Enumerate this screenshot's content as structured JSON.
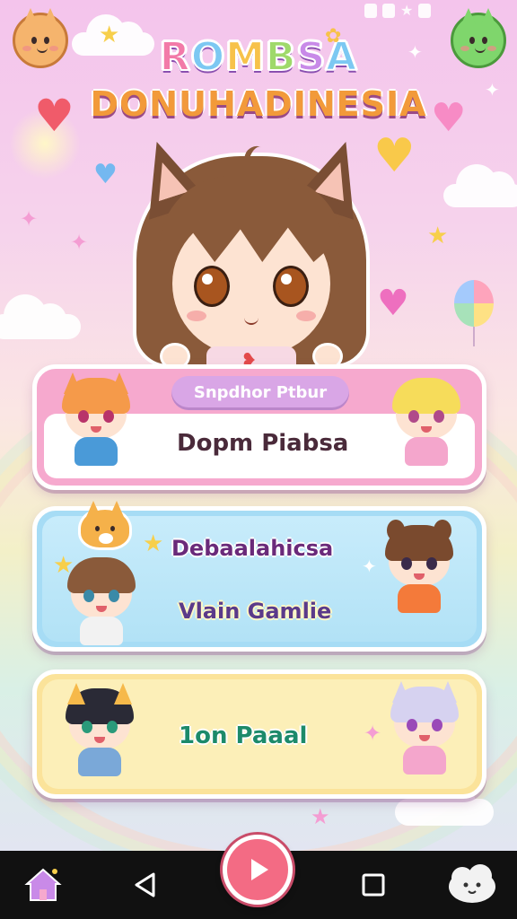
{
  "logo": {
    "title": "ROMBSA",
    "title_parts": [
      "R",
      "O",
      "M",
      "B",
      "S",
      "A"
    ],
    "subtitle": "DONUHADINESIA"
  },
  "menu": {
    "card1": {
      "tag": "Snpdhor Ptbur",
      "label": "Dopm Piabsa"
    },
    "card2": {
      "line1": "Debaalahicsa",
      "line2": "Vlain Gamlie"
    },
    "card3": {
      "label": "1on Paaal"
    }
  },
  "navbar": {
    "home_icon": "home-icon",
    "back_icon": "back-triangle-icon",
    "play_icon": "play-icon",
    "recents_icon": "square-icon",
    "pet_icon": "cloud-pet-icon"
  },
  "colors": {
    "pink_card": "#f6a9ce",
    "blue_card": "#a6dcf5",
    "yellow_card": "#fbe39a",
    "play_button": "#f36b84",
    "navbar": "#111111"
  }
}
